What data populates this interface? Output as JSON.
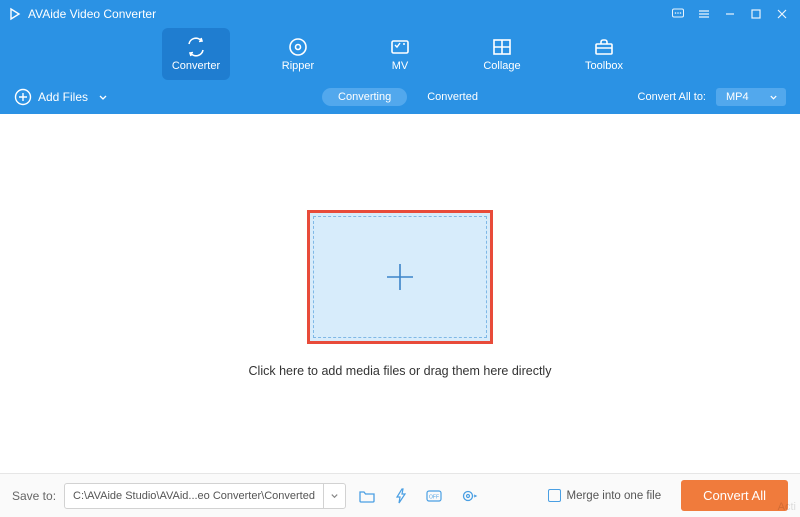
{
  "title": "AVAide Video Converter",
  "nav": {
    "converter": "Converter",
    "ripper": "Ripper",
    "mv": "MV",
    "collage": "Collage",
    "toolbox": "Toolbox"
  },
  "subbar": {
    "add_files": "Add Files",
    "converting": "Converting",
    "converted": "Converted",
    "convert_all_to": "Convert All to:",
    "format": "MP4"
  },
  "main": {
    "hint": "Click here to add media files or drag them here directly"
  },
  "bottom": {
    "save_to_label": "Save to:",
    "path": "C:\\AVAide Studio\\AVAid...eo Converter\\Converted",
    "merge_label": "Merge into one file",
    "convert_all": "Convert All"
  },
  "watermark": "Acti"
}
